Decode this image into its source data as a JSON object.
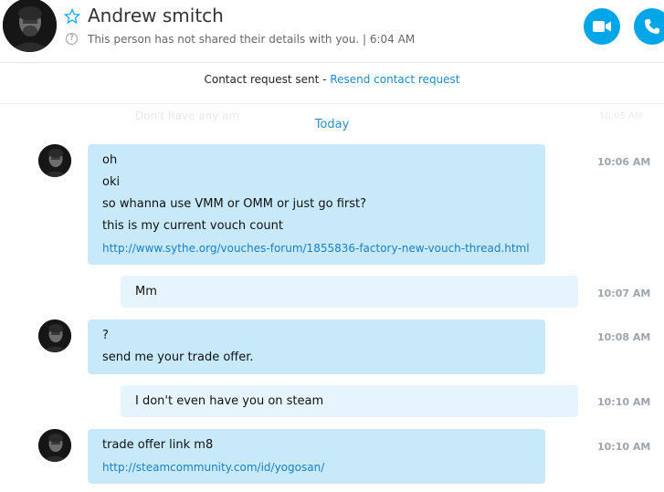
{
  "header": {
    "contact_name": "Andrew smitch",
    "status_text": "This person has not shared their details with you.  |  6:04 AM",
    "info_glyph": "?",
    "icons": [
      "avatar",
      "favorite-star-icon",
      "info-icon",
      "video-call-icon",
      "phone-call-icon"
    ],
    "accent_color": "#00a6e8"
  },
  "banner": {
    "text": "Contact request sent - ",
    "link_label": "Resend contact request"
  },
  "history": {
    "faded_text": "Don't have any am",
    "faded_time": "10:05 AM"
  },
  "date_separator": "Today",
  "messages": [
    {
      "direction": "incoming",
      "time": "10:06 AM",
      "lines": [
        "oh",
        "oki",
        "so whanna use VMM or OMM or just go first?",
        "this is my current vouch count"
      ],
      "link": "http://www.sythe.org/vouches-forum/1855836-factory-new-vouch-thread.html"
    },
    {
      "direction": "outgoing",
      "time": "10:07 AM",
      "lines": [
        "Mm"
      ]
    },
    {
      "direction": "incoming",
      "time": "10:08 AM",
      "lines": [
        "?",
        "send me your trade offer."
      ]
    },
    {
      "direction": "outgoing",
      "time": "10:10 AM",
      "lines": [
        "I don't even have you on steam"
      ]
    },
    {
      "direction": "incoming",
      "time": "10:10 AM",
      "lines": [
        "trade offer link m8"
      ],
      "link": "http://steamcommunity.com/id/yogosan/"
    }
  ],
  "colors": {
    "incoming_bubble": "#c7e9fa",
    "outgoing_bubble": "#e6f5fd",
    "link": "#1a7fc1",
    "timestamp": "#9aa5b0"
  }
}
